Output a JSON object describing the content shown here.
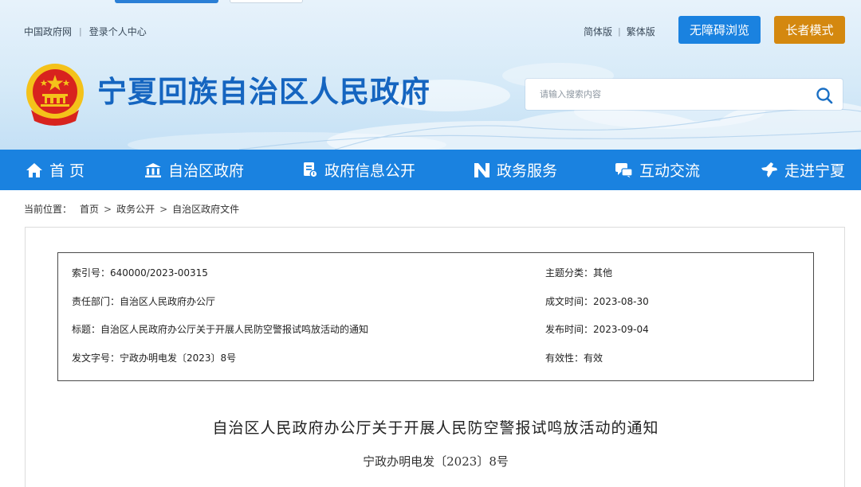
{
  "header": {
    "top_links": [
      "中国政府网",
      "登录个人中心"
    ],
    "separator": "|",
    "lang_links": [
      "简体版",
      "繁体版"
    ],
    "accessible_label": "无障碍浏览",
    "elder_label": "长者模式",
    "site_title": "宁夏回族自治区人民政府",
    "search_placeholder": "请输入搜索内容"
  },
  "nav": {
    "items": [
      {
        "label": "首 页",
        "icon": "home-icon"
      },
      {
        "label": "自治区政府",
        "icon": "government-building-icon"
      },
      {
        "label": "政府信息公开",
        "icon": "document-info-icon"
      },
      {
        "label": "政务服务",
        "icon": "service-n-icon"
      },
      {
        "label": "互动交流",
        "icon": "chat-icon"
      },
      {
        "label": "走进宁夏",
        "icon": "ningxia-map-icon"
      }
    ]
  },
  "breadcrumb": {
    "prefix": "当前位置：",
    "items": [
      "首页",
      "政务公开",
      "自治区政府文件"
    ],
    "separator": ">"
  },
  "meta": {
    "index_no": "索引号：640000/2023-00315",
    "topic": "主题分类：其他",
    "dept": "责任部门：自治区人民政府办公厅",
    "created": "成文时间：2023-08-30",
    "subject": "标题：自治区人民政府办公厅关于开展人民防空警报试鸣放活动的通知",
    "published": "发布时间：2023-09-04",
    "doc_code": "发文字号：宁政办明电发〔2023〕8号",
    "validity": "有效性：有效"
  },
  "document": {
    "title": "自治区人民政府办公厅关于开展人民防空警报试鸣放活动的通知",
    "number": "宁政办明电发〔2023〕8号"
  },
  "colors": {
    "nav_blue": "#1a82e0",
    "title_blue": "#1565c0",
    "elder_orange": "#d4880f",
    "emblem_red": "#d8231e",
    "emblem_gold": "#f4c21a"
  }
}
